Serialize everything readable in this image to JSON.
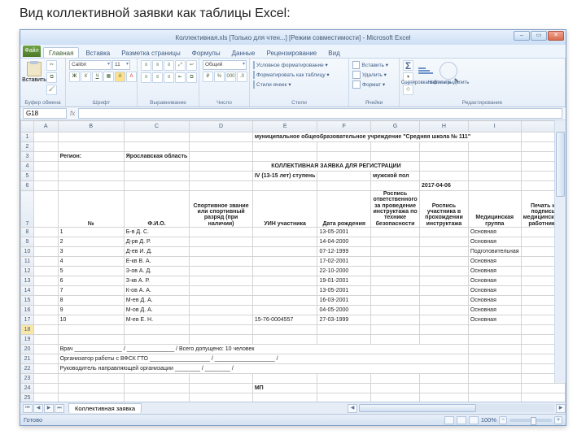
{
  "slide": {
    "title": "Вид коллективной заявки как таблицы Excel:"
  },
  "window": {
    "title": "Коллективная.xls [Только для чтен...] [Режим совместимости] - Microsoft Excel",
    "min": "–",
    "max": "▭",
    "close": "✕"
  },
  "tabs": {
    "file": "Файл",
    "items": [
      "Главная",
      "Вставка",
      "Разметка страницы",
      "Формулы",
      "Данные",
      "Рецензирование",
      "Вид"
    ],
    "active": 0
  },
  "ribbon": {
    "clipboard": {
      "paste": "Вставить",
      "label": "Буфер обмена"
    },
    "font": {
      "name": "Calibri",
      "size": "11",
      "label": "Шрифт"
    },
    "align": {
      "label": "Выравнивание"
    },
    "number": {
      "format": "Общий",
      "label": "Число"
    },
    "styles": {
      "condfmt": "Условное форматирование ▾",
      "astable": "Форматировать как таблицу ▾",
      "cellstyles": "Стили ячеек ▾",
      "label": "Стили"
    },
    "cells": {
      "insert": "Вставить ▾",
      "delete": "Удалить ▾",
      "format": "Формат ▾",
      "label": "Ячейки"
    },
    "editing": {
      "sum": "Σ",
      "sort": "Сортировка и фильтр",
      "find": "Найти и выделить",
      "label": "Редактирование"
    }
  },
  "namebox": "G18",
  "columns": [
    "",
    "A",
    "B",
    "C",
    "D",
    "E",
    "F",
    "G",
    "H",
    "I"
  ],
  "content": {
    "r1_e": "муниципальное общеобразовательное учреждение \"Средняя школа № 111\"",
    "r3_b": "Регион:",
    "r3_c": "Ярославская область",
    "r4_e": "КОЛЛЕКТИВНАЯ ЗАЯВКА ДЛЯ РЕГИСТРАЦИИ",
    "r5_e": "IV (13-15 лет) ступень",
    "r5_g": "мужской пол",
    "r6_h": "2017-04-06",
    "hdr": {
      "b": "№",
      "c": "Ф.И.О.",
      "d": "Спортивное звание или спортивный разряд (при наличии)",
      "e": "УИН участника",
      "f": "Дата рождения",
      "g": "Роспись ответственного за проведение инструктажа по технике безопасности",
      "h": "Роспись участника в прохождении инструктажа",
      "i": "Медицинская группа",
      "j": "Печать и подпись медицинского работника"
    },
    "rows": [
      {
        "n": "1",
        "fio": "Б-в Д. С.",
        "dob": "13-05-2001",
        "med": "Основная"
      },
      {
        "n": "2",
        "fio": "Д-рв Д. Р.",
        "dob": "14-04-2000",
        "med": "Основная"
      },
      {
        "n": "3",
        "fio": "Д-ев И. Д.",
        "dob": "07-12-1999",
        "med": "Подготовительная"
      },
      {
        "n": "4",
        "fio": "Е-кв В. А.",
        "dob": "17-02-2001",
        "med": "Основная"
      },
      {
        "n": "5",
        "fio": "З-ов А. Д.",
        "dob": "22-10-2000",
        "med": "Основная"
      },
      {
        "n": "6",
        "fio": "З-кв А. Р.",
        "dob": "19-01-2001",
        "med": "Основная"
      },
      {
        "n": "7",
        "fio": "К-ов А. А.",
        "dob": "13-05-2001",
        "med": "Основная"
      },
      {
        "n": "8",
        "fio": "М-ев Д. А.",
        "dob": "16-03-2001",
        "med": "Основная"
      },
      {
        "n": "9",
        "fio": "М-ов Д. А.",
        "dob": "04-05-2000",
        "med": "Основная"
      },
      {
        "n": "10",
        "fio": "М-ев Е. Н.",
        "uin": "15-76-0004557",
        "dob": "27-03-1999",
        "med": "Основная"
      }
    ],
    "r20": "Врач _______________ / _______________ / Всего допущено: 10 человек",
    "r21": "Организатор работы с ВФСК ГТО ___________________ / ___________________ /",
    "r22": "Руководитель направляющей организации ________ / ________ /",
    "r24": "МП"
  },
  "sheet_tab": "Коллективная заявка",
  "status": {
    "ready": "Готово",
    "zoom": "100%"
  }
}
